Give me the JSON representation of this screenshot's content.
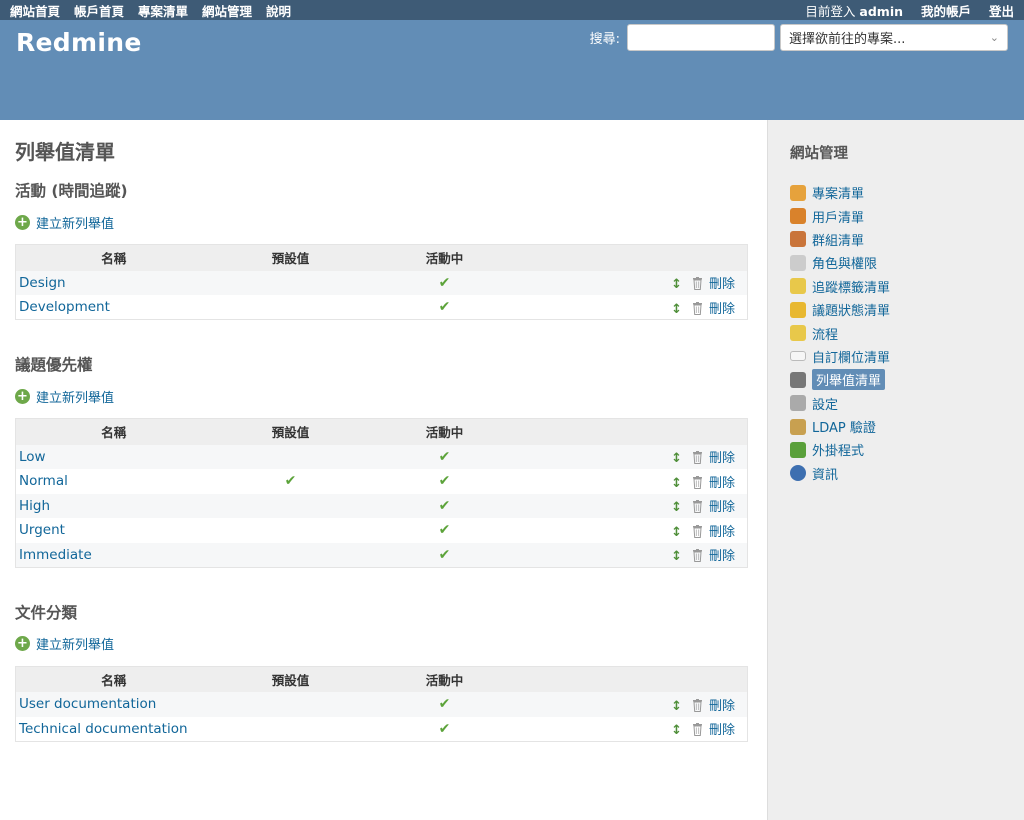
{
  "top_menu": {
    "left": [
      "網站首頁",
      "帳戶首頁",
      "專案清單",
      "網站管理",
      "說明"
    ],
    "logged_as_label": "目前登入",
    "user": "admin",
    "my_account": "我的帳戶",
    "logout": "登出"
  },
  "header": {
    "title": "Redmine",
    "search_label": "搜尋:",
    "search_value": "",
    "project_select": "選擇欲前往的專案..."
  },
  "page": {
    "title": "列舉值清單"
  },
  "sections": [
    {
      "title": "活動 (時間追蹤)",
      "new_link": "建立新列舉值",
      "columns": [
        "名稱",
        "預設值",
        "活動中"
      ],
      "rows": [
        {
          "name": "Design",
          "default": false,
          "active": true,
          "delete": "刪除"
        },
        {
          "name": "Development",
          "default": false,
          "active": true,
          "delete": "刪除"
        }
      ]
    },
    {
      "title": "議題優先權",
      "new_link": "建立新列舉值",
      "columns": [
        "名稱",
        "預設值",
        "活動中"
      ],
      "rows": [
        {
          "name": "Low",
          "default": false,
          "active": true,
          "delete": "刪除"
        },
        {
          "name": "Normal",
          "default": true,
          "active": true,
          "delete": "刪除"
        },
        {
          "name": "High",
          "default": false,
          "active": true,
          "delete": "刪除"
        },
        {
          "name": "Urgent",
          "default": false,
          "active": true,
          "delete": "刪除"
        },
        {
          "name": "Immediate",
          "default": false,
          "active": true,
          "delete": "刪除"
        }
      ]
    },
    {
      "title": "文件分類",
      "new_link": "建立新列舉值",
      "columns": [
        "名稱",
        "預設值",
        "活動中"
      ],
      "rows": [
        {
          "name": "User documentation",
          "default": false,
          "active": true,
          "delete": "刪除"
        },
        {
          "name": "Technical documentation",
          "default": false,
          "active": true,
          "delete": "刪除"
        }
      ]
    }
  ],
  "sidebar": {
    "title": "網站管理",
    "items": [
      {
        "label": "專案清單",
        "icon": "projects-icon",
        "color": "#e6a23c"
      },
      {
        "label": "用戶清單",
        "icon": "user-icon",
        "color": "#d9822b"
      },
      {
        "label": "群組清單",
        "icon": "group-icon",
        "color": "#c9743a"
      },
      {
        "label": "角色與權限",
        "icon": "roles-icon",
        "color": "#cccccc"
      },
      {
        "label": "追蹤標籤清單",
        "icon": "tracker-icon",
        "color": "#e8c84a"
      },
      {
        "label": "議題狀態清單",
        "icon": "issue-status-icon",
        "color": "#e8b830"
      },
      {
        "label": "流程",
        "icon": "workflow-icon",
        "color": "#e8c84a"
      },
      {
        "label": "自訂欄位清單",
        "icon": "custom-field-icon",
        "color": "#f6f6f6"
      },
      {
        "label": "列舉值清單",
        "icon": "enumeration-icon",
        "color": "#777777",
        "selected": true
      },
      {
        "label": "設定",
        "icon": "settings-icon",
        "color": "#aaaaaa"
      },
      {
        "label": "LDAP 驗證",
        "icon": "ldap-icon",
        "color": "#c8a050"
      },
      {
        "label": "外掛程式",
        "icon": "plugin-icon",
        "color": "#5aa03a"
      },
      {
        "label": "資訊",
        "icon": "info-icon",
        "color": "#3d6fb0"
      }
    ]
  }
}
